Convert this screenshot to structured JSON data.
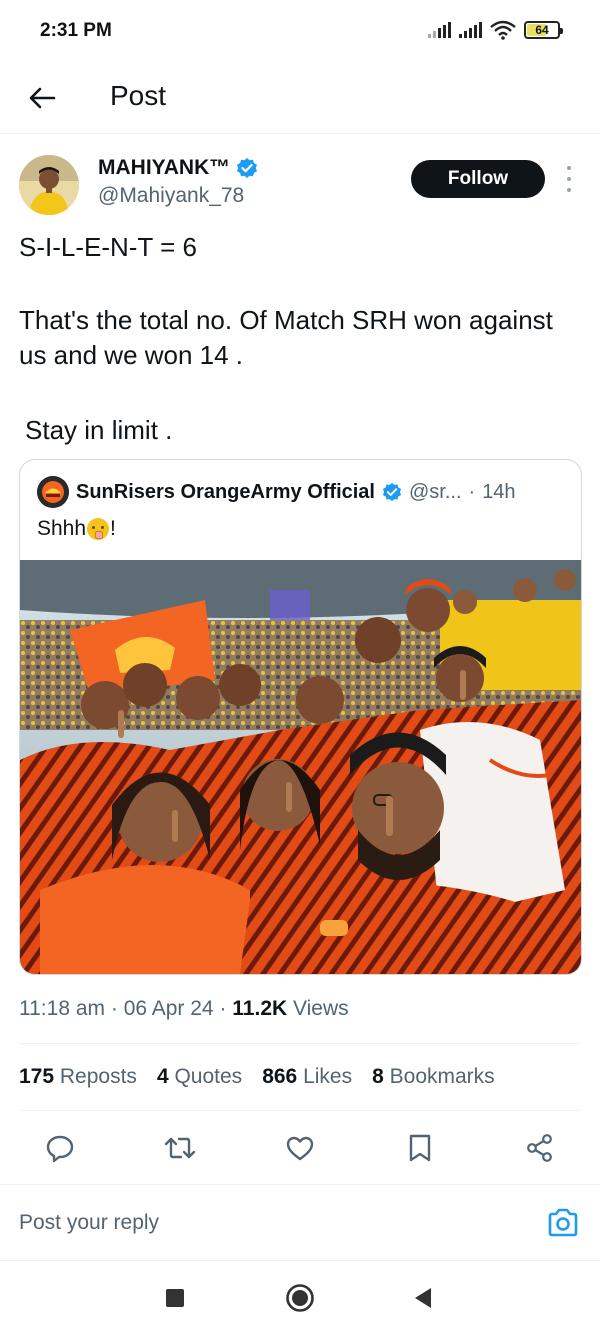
{
  "status_bar": {
    "time": "2:31 PM",
    "battery": "64",
    "battery_level": 0.64
  },
  "header": {
    "title": "Post"
  },
  "author": {
    "name": "MAHIYANK™",
    "handle": "@Mahiyank_78",
    "verified": true,
    "follow_label": "Follow"
  },
  "post": {
    "line1": "S-I-L-E-N-T = 6",
    "line2": "That's the total no. Of Match SRH won against us and we won 14 .",
    "line3": "Stay in limit ."
  },
  "quote": {
    "name": "SunRisers OrangeArmy Official",
    "handle": "@sr...",
    "dot": "·",
    "time": "14h",
    "text_before": "Shhh",
    "text_after": "!",
    "verified": true
  },
  "meta": {
    "time": "11:18 am",
    "sep1": "·",
    "date": "06 Apr 24",
    "sep2": "·",
    "views_count": "11.2K",
    "views_label": "Views"
  },
  "stats": [
    {
      "count": "175",
      "label": "Reposts"
    },
    {
      "count": "4",
      "label": "Quotes"
    },
    {
      "count": "866",
      "label": "Likes"
    },
    {
      "count": "8",
      "label": "Bookmarks"
    }
  ],
  "actions": [
    "reply-icon",
    "repost-icon",
    "like-icon",
    "bookmark-icon",
    "share-icon"
  ],
  "reply": {
    "placeholder": "Post your reply"
  },
  "colors": {
    "accent": "#1d9bf0",
    "srh_orange": "#f26522",
    "text": "#0f1419",
    "muted": "#536471"
  }
}
